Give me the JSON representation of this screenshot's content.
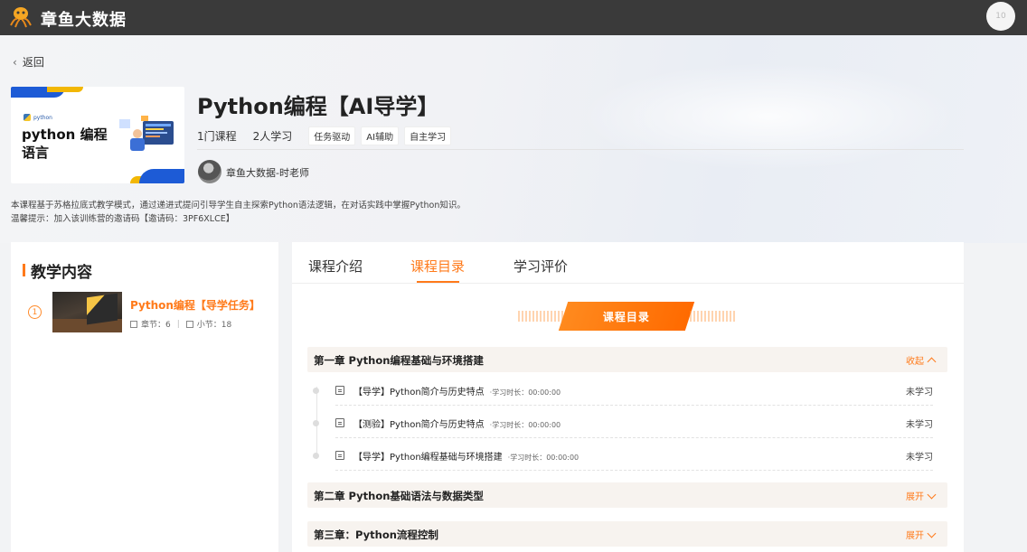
{
  "header": {
    "brand": "章鱼大数据",
    "avatar_text": "10"
  },
  "nav": {
    "back_label": "返回"
  },
  "course": {
    "cover": {
      "small_label": "python",
      "line1": "python 编程",
      "line2": "语言"
    },
    "title": "Python编程【AI导学】",
    "courses_count": "1门课程",
    "learners": "2人学习",
    "tags": [
      "任务驱动",
      "AI辅助",
      "自主学习"
    ],
    "teacher": "章鱼大数据-时老师",
    "description": "本课程基于苏格拉底式教学模式，通过递进式提问引导学生自主探索Python语法逻辑，在对话实践中掌握Python知识。",
    "tip": "温馨提示：加入该训练营的邀请码【邀请码：3PF6XLCE】"
  },
  "left_panel": {
    "title": "教学内容",
    "items": [
      {
        "index": "1",
        "name": "Python编程【导学任务】",
        "chapters": "章节：6",
        "sections": "小节：18"
      }
    ]
  },
  "tabs": [
    {
      "label": "课程介绍",
      "active": false
    },
    {
      "label": "课程目录",
      "active": true
    },
    {
      "label": "学习评价",
      "active": false
    }
  ],
  "catalog": {
    "banner": "课程目录",
    "chapters": [
      {
        "title": "第一章 Python编程基础与环境搭建",
        "toggle": "收起",
        "lessons": [
          {
            "title": "【导学】Python简介与历史特点",
            "duration": "·学习时长：00:00:00",
            "status": "未学习"
          },
          {
            "title": "【测验】Python简介与历史特点",
            "duration": "·学习时长：00:00:00",
            "status": "未学习"
          },
          {
            "title": "【导学】Python编程基础与环境搭建",
            "duration": "·学习时长：00:00:00",
            "status": "未学习"
          }
        ]
      },
      {
        "title": "第二章 Python基础语法与数据类型",
        "toggle": "展开",
        "lessons": []
      },
      {
        "title": "第三章：Python流程控制",
        "toggle": "展开",
        "lessons": []
      }
    ]
  },
  "colors": {
    "accent": "#ff7a1a",
    "topbar": "#3a3a3a",
    "cover_blue": "#1d5bd6",
    "cover_yellow": "#f2b705"
  },
  "icons": {
    "logo": "octopus-logo-icon",
    "back": "chevron-left-icon",
    "chapter_count": "chapter-icon",
    "section_count": "section-icon",
    "lesson": "document-icon",
    "collapse": "chevron-up-icon",
    "expand": "chevron-down-icon"
  }
}
